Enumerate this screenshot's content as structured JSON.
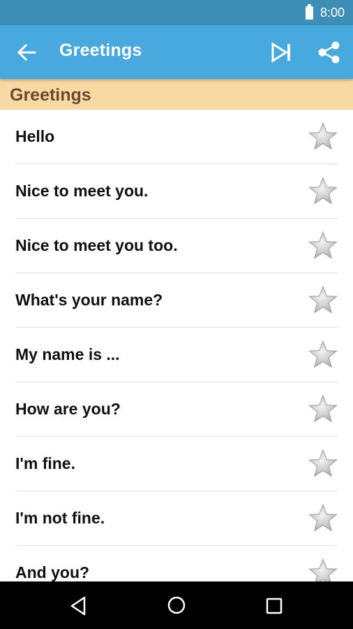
{
  "status_bar": {
    "time": "8:00",
    "icons": [
      "battery-icon"
    ]
  },
  "app_bar": {
    "title": "Greetings",
    "icons": [
      "back-arrow-icon",
      "skip-next-icon",
      "share-icon"
    ]
  },
  "section": {
    "title": "Greetings"
  },
  "phrases": [
    {
      "text": "Hello",
      "starred": false
    },
    {
      "text": "Nice to meet you.",
      "starred": false
    },
    {
      "text": "Nice to meet you too.",
      "starred": false
    },
    {
      "text": "What's your name?",
      "starred": false
    },
    {
      "text": "My name is ...",
      "starred": false
    },
    {
      "text": "How are you?",
      "starred": false
    },
    {
      "text": "I'm fine.",
      "starred": false
    },
    {
      "text": "I'm not fine.",
      "starred": false
    },
    {
      "text": "And you?",
      "starred": false
    }
  ],
  "nav_bar": {
    "icons": [
      "nav-back-icon",
      "nav-home-icon",
      "nav-recents-icon"
    ]
  },
  "colors": {
    "status_bar": "#3d8fb8",
    "app_bar": "#47a9de",
    "section_header": "#f9d9a3",
    "section_text": "#6d4a2e",
    "star": "#bdbdbd"
  }
}
